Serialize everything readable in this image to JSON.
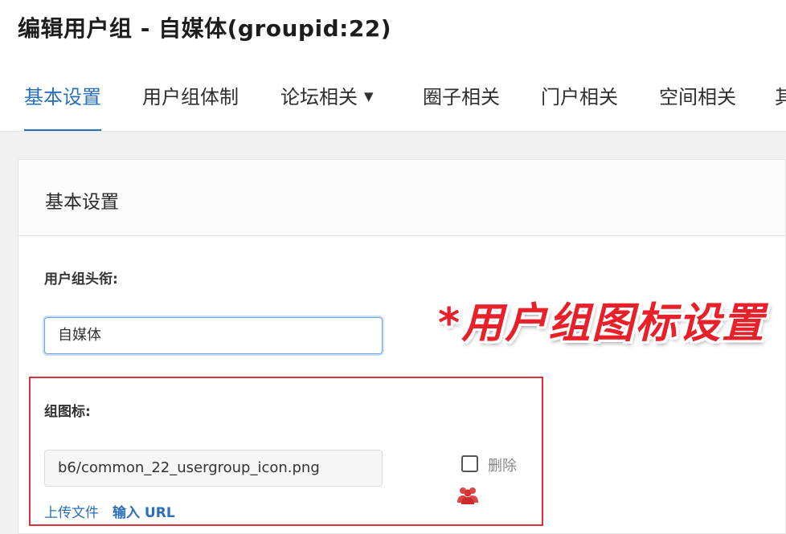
{
  "page": {
    "title": "编辑用户组 - 自媒体(groupid:22)"
  },
  "tabs": [
    {
      "label": "基本设置",
      "active": true
    },
    {
      "label": "用户组体制",
      "active": false
    },
    {
      "label": "论坛相关",
      "active": false,
      "has_dropdown": true,
      "dropdown_icon": "caret-down-icon"
    },
    {
      "label": "圈子相关",
      "active": false
    },
    {
      "label": "门户相关",
      "active": false
    },
    {
      "label": "空间相关",
      "active": false
    },
    {
      "label": "其",
      "active": false
    }
  ],
  "card": {
    "header_title": "基本设置"
  },
  "fields": {
    "group_title": {
      "label": "用户组头衔:",
      "value": "自媒体"
    },
    "group_icon": {
      "label": "组图标:",
      "value": "b6/common_22_usergroup_icon.png",
      "delete_label": "删除",
      "delete_checked": false,
      "preview_icon": "users-group-icon",
      "upload_link": "上传文件",
      "url_link": "输入 URL"
    }
  },
  "annotation": {
    "text": "*用户组图标设置"
  },
  "colors": {
    "accent": "#2a6fba",
    "annotation_red": "#e8202a",
    "highlight_box": "#d9323c",
    "content_background": "#f1f1f1"
  }
}
